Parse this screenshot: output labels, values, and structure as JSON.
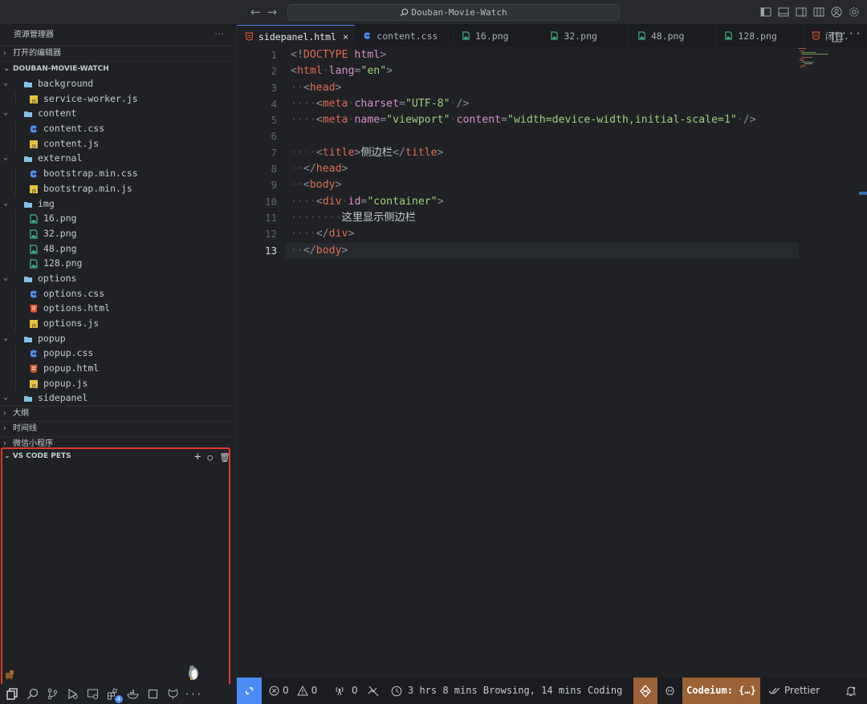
{
  "window": {
    "search_text": "Douban-Movie-Watch",
    "nav_icons": [
      "arrow-left-icon",
      "arrow-right-icon"
    ],
    "layout_icons": [
      "toggle-primary-sidebar-icon",
      "toggle-panel-icon",
      "toggle-secondary-sidebar-icon",
      "customize-layout-icon",
      "account-icon",
      "settings-gear-icon"
    ]
  },
  "sidebar": {
    "title": "资源管理器",
    "more": "···",
    "open_editors": "打开的编辑器",
    "project": "DOUBAN-MOVIE-WATCH",
    "tree": [
      {
        "type": "folder",
        "name": "background",
        "depth": 0,
        "open": true
      },
      {
        "type": "js",
        "name": "service-worker.js",
        "depth": 1
      },
      {
        "type": "folder",
        "name": "content",
        "depth": 0,
        "open": true
      },
      {
        "type": "css",
        "name": "content.css",
        "depth": 1
      },
      {
        "type": "js",
        "name": "content.js",
        "depth": 1
      },
      {
        "type": "folder",
        "name": "external",
        "depth": 0,
        "open": true
      },
      {
        "type": "css",
        "name": "bootstrap.min.css",
        "depth": 1
      },
      {
        "type": "js",
        "name": "bootstrap.min.js",
        "depth": 1
      },
      {
        "type": "folder",
        "name": "img",
        "depth": 0,
        "open": true
      },
      {
        "type": "png",
        "name": "16.png",
        "depth": 1
      },
      {
        "type": "png",
        "name": "32.png",
        "depth": 1
      },
      {
        "type": "png",
        "name": "48.png",
        "depth": 1
      },
      {
        "type": "png",
        "name": "128.png",
        "depth": 1
      },
      {
        "type": "folder",
        "name": "options",
        "depth": 0,
        "open": true
      },
      {
        "type": "css",
        "name": "options.css",
        "depth": 1
      },
      {
        "type": "html",
        "name": "options.html",
        "depth": 1
      },
      {
        "type": "js",
        "name": "options.js",
        "depth": 1
      },
      {
        "type": "folder",
        "name": "popup",
        "depth": 0,
        "open": true
      },
      {
        "type": "css",
        "name": "popup.css",
        "depth": 1
      },
      {
        "type": "html",
        "name": "popup.html",
        "depth": 1
      },
      {
        "type": "js",
        "name": "popup.js",
        "depth": 1
      },
      {
        "type": "folder",
        "name": "sidepanel",
        "depth": 0,
        "open": true
      }
    ],
    "sections": [
      "大纲",
      "时间线",
      "微信小程序"
    ],
    "pets_title": "VS CODE PETS",
    "pets_actions": [
      "+",
      "○",
      "🗑"
    ]
  },
  "activity_bar": {
    "icons": [
      "explorer-icon",
      "search-icon",
      "source-control-icon",
      "run-debug-icon",
      "remote-explorer-icon",
      "extensions-icon",
      "docker-icon",
      "stop-icon",
      "github-icon",
      "more-icon"
    ],
    "extensions_badge": "4",
    "more": "···"
  },
  "tabs": [
    {
      "label": "sidepanel.html",
      "type": "html",
      "active": true,
      "close": "×"
    },
    {
      "label": "content.css",
      "type": "css"
    },
    {
      "label": "16.png",
      "type": "png"
    },
    {
      "label": "32.png",
      "type": "png"
    },
    {
      "label": "48.png",
      "type": "png"
    },
    {
      "label": "128.png",
      "type": "png"
    },
    {
      "label": "闭包.",
      "type": "html"
    }
  ],
  "tab_actions": {
    "split": "split-editor-icon",
    "more": "···"
  },
  "editor": {
    "current_line": 13,
    "line_numbers": [
      "1",
      "2",
      "3",
      "4",
      "5",
      "6",
      "7",
      "8",
      "9",
      "10",
      "11",
      "12",
      "13"
    ]
  },
  "status": {
    "errors": "0",
    "warnings": "0",
    "ports": "0",
    "wakatime": "3 hrs 8 mins Browsing, 14 mins Coding",
    "codeium": "Codeium: {…}",
    "prettier": "Prettier",
    "remote_icon": "remote-indicator-icon",
    "colors": {
      "remote": "#4c8bf5",
      "codeium": "#9a6236",
      "highlight_border": "#e0392b"
    }
  }
}
